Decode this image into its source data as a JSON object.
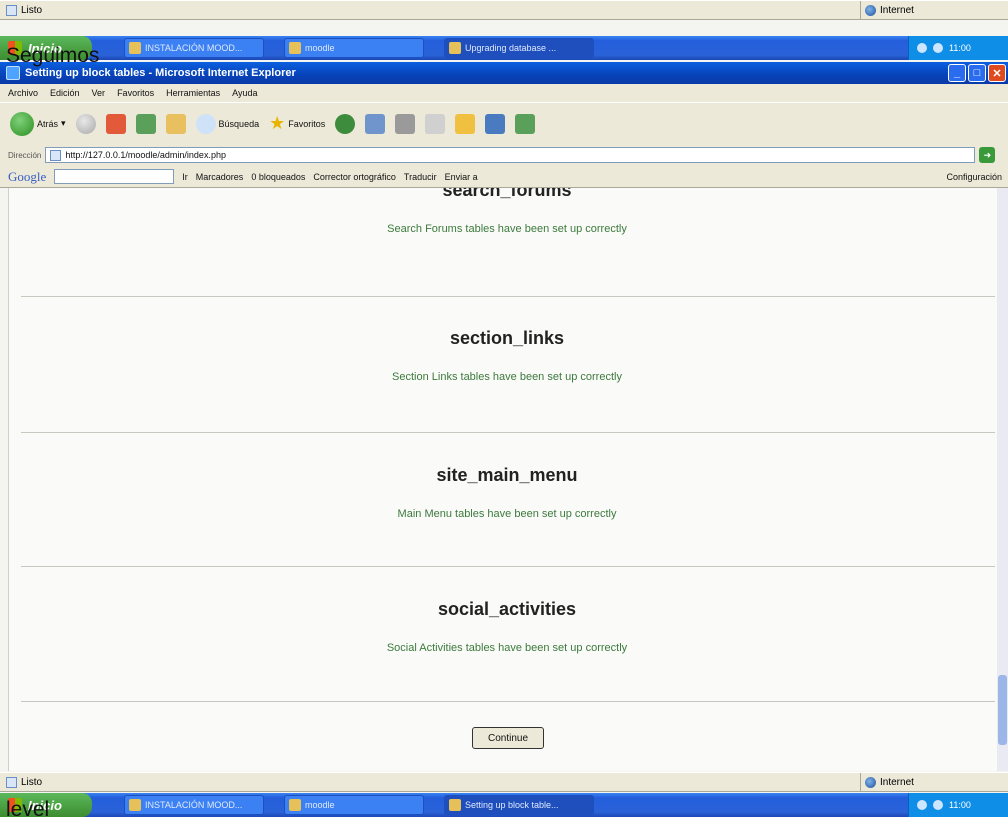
{
  "top_status": {
    "left_text": "Listo",
    "zone_text": "Internet"
  },
  "top_taskbar": {
    "start_label": "Inicio",
    "buttons": [
      "INSTALACIÓN MOOD...",
      "moodle",
      "Upgrading database ..."
    ],
    "clock": "11:00"
  },
  "overlay_top": "Seguimos",
  "browser": {
    "window_title": "Setting up block tables - Microsoft Internet Explorer",
    "menu": [
      "Archivo",
      "Edición",
      "Ver",
      "Favoritos",
      "Herramientas",
      "Ayuda"
    ],
    "toolbar": {
      "back": "Atrás",
      "search": "Búsqueda",
      "favorites": "Favoritos"
    },
    "address_label": "Dirección",
    "address": "http://127.0.0.1/moodle/admin/index.php",
    "google_bar": {
      "logo": "Google",
      "items": [
        "Ir",
        "Marcadores",
        "0 bloqueados",
        "Corrector ortográfico",
        "Traducir",
        "Enviar a"
      ],
      "settings": "Configuración"
    }
  },
  "page": {
    "sections": [
      {
        "title": "search_forums",
        "message": "Search Forums tables have been set up correctly"
      },
      {
        "title": "section_links",
        "message": "Section Links tables have been set up correctly"
      },
      {
        "title": "site_main_menu",
        "message": "Main Menu tables have been set up correctly"
      },
      {
        "title": "social_activities",
        "message": "Social Activities tables have been set up correctly"
      }
    ],
    "continue_label": "Continue"
  },
  "bottom_status": {
    "left_text": "Listo",
    "zone_text": "Internet"
  },
  "bottom_taskbar": {
    "start_label": "Inicio",
    "buttons": [
      "INSTALACIÓN MOOD...",
      "moodle",
      "Setting up block table..."
    ],
    "clock": "11:00"
  },
  "overlay_bottom": "level"
}
